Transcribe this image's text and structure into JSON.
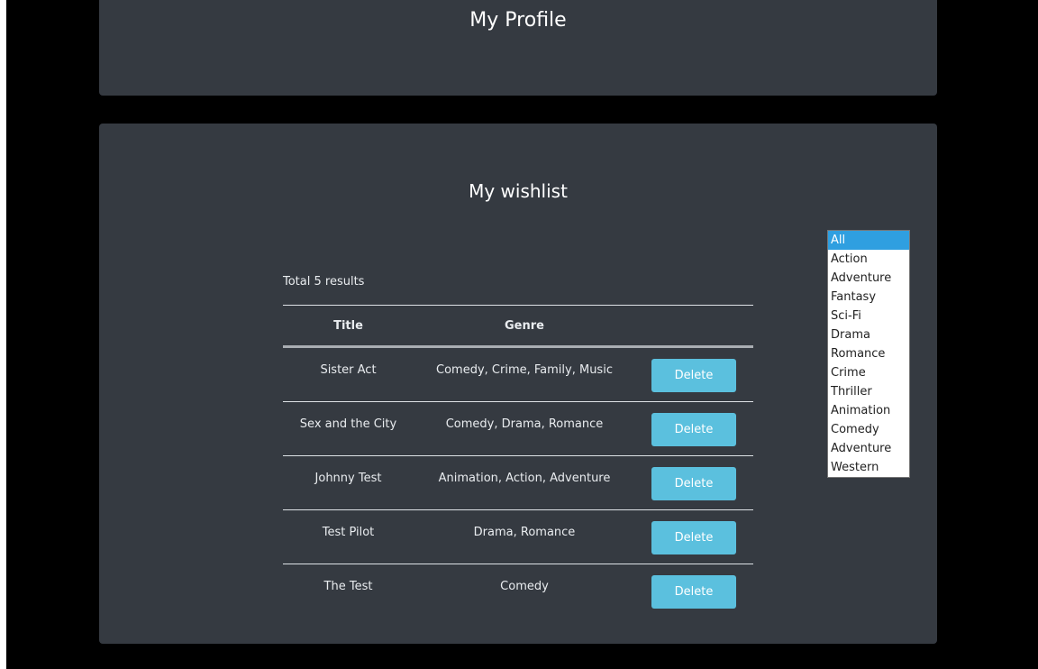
{
  "profile": {
    "title": "My Profile"
  },
  "wishlist": {
    "title": "My wishlist",
    "total_results": "Total 5 results",
    "columns": {
      "title": "Title",
      "genre": "Genre"
    },
    "rows": [
      {
        "title": "Sister Act",
        "genre": "Comedy, Crime, Family, Music",
        "action": "Delete"
      },
      {
        "title": "Sex and the City",
        "genre": "Comedy, Drama, Romance",
        "action": "Delete"
      },
      {
        "title": "Johnny Test",
        "genre": "Animation, Action, Adventure",
        "action": "Delete"
      },
      {
        "title": "Test Pilot",
        "genre": "Drama, Romance",
        "action": "Delete"
      },
      {
        "title": "The Test",
        "genre": "Comedy",
        "action": "Delete"
      }
    ]
  },
  "genre_filter": {
    "selected": "All",
    "options": [
      "All",
      "Action",
      "Adventure",
      "Fantasy",
      "Sci-Fi",
      "Drama",
      "Romance",
      "Crime",
      "Thriller",
      "Animation",
      "Comedy",
      "Adventure",
      "Western"
    ]
  },
  "colors": {
    "page_background": "#000000",
    "card_background": "#353a41",
    "delete_button": "#5bc0de",
    "selected_option": "#2f9fe0"
  }
}
